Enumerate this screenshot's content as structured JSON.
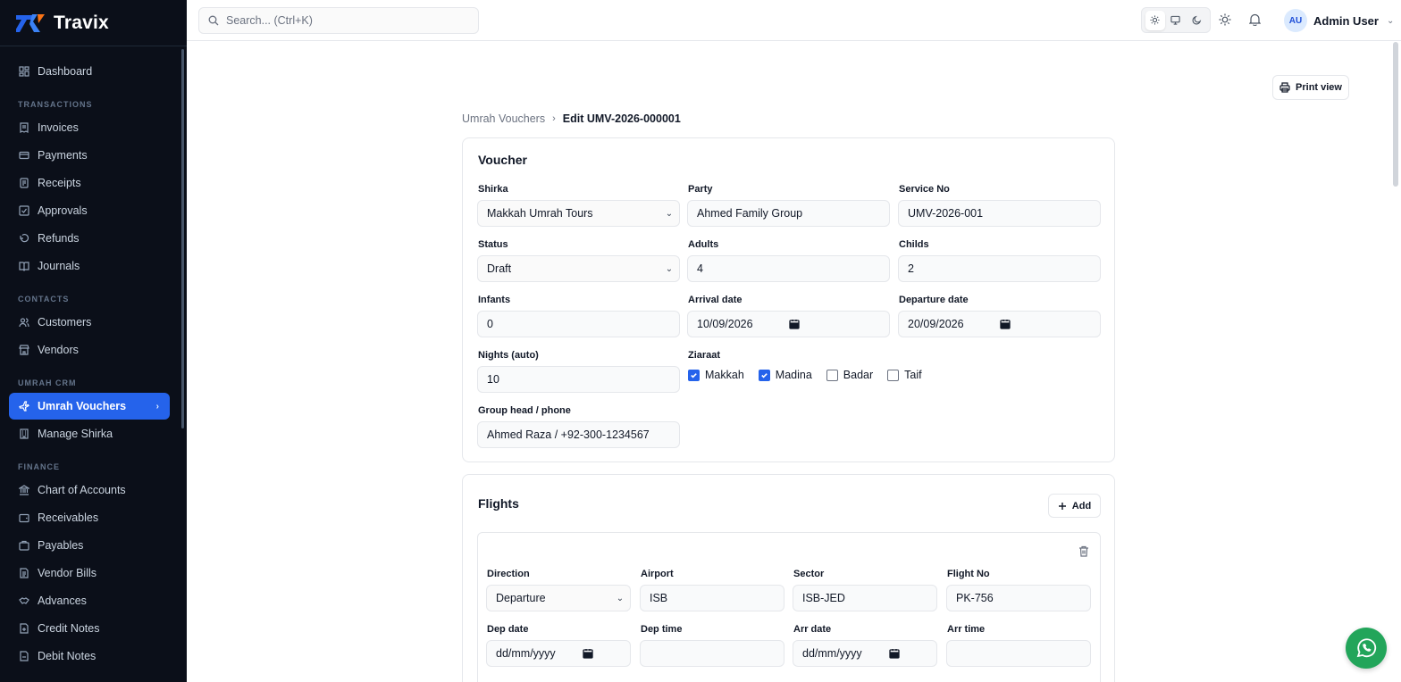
{
  "app": {
    "name": "Travix",
    "brand_color": "#2563eb"
  },
  "topbar": {
    "search_placeholder": "Search... (Ctrl+K)",
    "theme_options": [
      "light",
      "system",
      "dark"
    ],
    "user": {
      "initials": "AU",
      "name": "Admin User"
    }
  },
  "sidebar": {
    "dashboard": "Dashboard",
    "sections": [
      {
        "label": "TRANSACTIONS",
        "items": [
          "Invoices",
          "Payments",
          "Receipts",
          "Approvals",
          "Refunds",
          "Journals"
        ]
      },
      {
        "label": "CONTACTS",
        "items": [
          "Customers",
          "Vendors"
        ]
      },
      {
        "label": "UMRAH CRM",
        "items": [
          "Umrah Vouchers",
          "Manage Shirka"
        ]
      },
      {
        "label": "FINANCE",
        "items": [
          "Chart of Accounts",
          "Receivables",
          "Payables",
          "Vendor Bills",
          "Advances",
          "Credit Notes",
          "Debit Notes"
        ]
      }
    ],
    "active_item": "Umrah Vouchers"
  },
  "page": {
    "print_label": "Print view",
    "breadcrumb": {
      "parent": "Umrah Vouchers",
      "current": "Edit UMV-2026-000001"
    }
  },
  "voucher": {
    "title": "Voucher",
    "shirka": {
      "label": "Shirka",
      "value": "Makkah Umrah Tours"
    },
    "party": {
      "label": "Party",
      "value": "Ahmed Family Group"
    },
    "service_no": {
      "label": "Service No",
      "value": "UMV-2026-001"
    },
    "status": {
      "label": "Status",
      "value": "Draft"
    },
    "adults": {
      "label": "Adults",
      "value": "4"
    },
    "childs": {
      "label": "Childs",
      "value": "2"
    },
    "infants": {
      "label": "Infants",
      "value": "0"
    },
    "arrival_date": {
      "label": "Arrival date",
      "value": "10/09/2026"
    },
    "departure_date": {
      "label": "Departure date",
      "value": "20/09/2026"
    },
    "nights": {
      "label": "Nights (auto)",
      "value": "10"
    },
    "ziaraat": {
      "label": "Ziaraat",
      "options": [
        {
          "name": "Makkah",
          "checked": true
        },
        {
          "name": "Madina",
          "checked": true
        },
        {
          "name": "Badar",
          "checked": false
        },
        {
          "name": "Taif",
          "checked": false
        }
      ]
    },
    "group_head": {
      "label": "Group head / phone",
      "value": "Ahmed Raza / +92-300-1234567"
    }
  },
  "flights": {
    "title": "Flights",
    "add_label": "Add",
    "rows": [
      {
        "direction": {
          "label": "Direction",
          "value": "Departure"
        },
        "airport": {
          "label": "Airport",
          "value": "ISB"
        },
        "sector": {
          "label": "Sector",
          "value": "ISB-JED"
        },
        "flight_no": {
          "label": "Flight No",
          "value": "PK-756"
        },
        "dep_date": {
          "label": "Dep date",
          "value": "dd/mm/yyyy"
        },
        "dep_time": {
          "label": "Dep time",
          "value": ""
        },
        "arr_date": {
          "label": "Arr date",
          "value": "dd/mm/yyyy"
        },
        "arr_time": {
          "label": "Arr time",
          "value": ""
        }
      }
    ]
  },
  "chat_widget": {
    "icon": "whatsapp-icon",
    "color": "#22a55a"
  }
}
